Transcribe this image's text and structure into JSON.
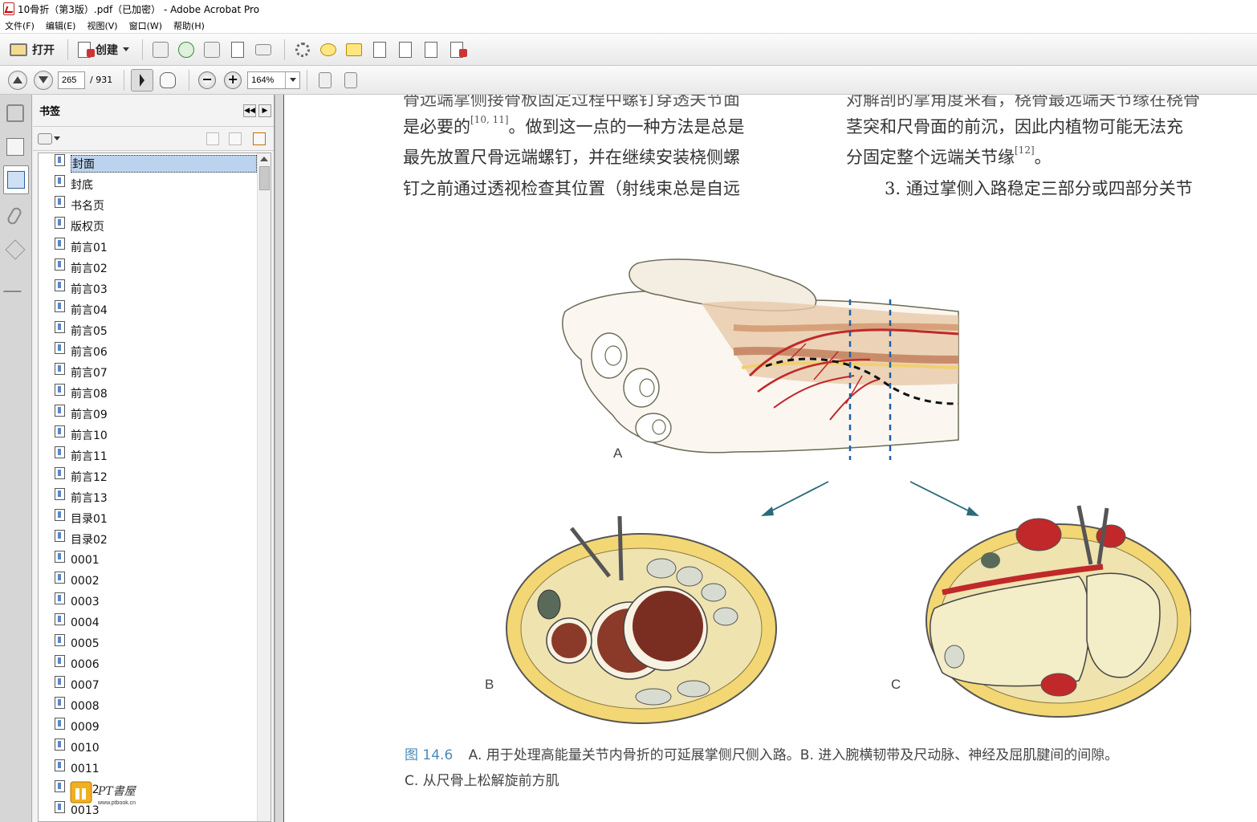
{
  "window": {
    "title": "10骨折（第3版）.pdf（已加密） - Adobe Acrobat Pro"
  },
  "menu": [
    "文件(F)",
    "编辑(E)",
    "视图(V)",
    "窗口(W)",
    "帮助(H)"
  ],
  "toolbar": {
    "open_label": "打开",
    "create_label": "创建"
  },
  "nav": {
    "current_page": "265",
    "total_pages": "/ 931",
    "zoom": "164%"
  },
  "bookmarks_panel": {
    "title": "书签",
    "items": [
      {
        "label": "封面",
        "selected": true
      },
      {
        "label": "封底"
      },
      {
        "label": "书名页"
      },
      {
        "label": "版权页"
      },
      {
        "label": "前言01"
      },
      {
        "label": "前言02"
      },
      {
        "label": "前言03"
      },
      {
        "label": "前言04"
      },
      {
        "label": "前言05"
      },
      {
        "label": "前言06"
      },
      {
        "label": "前言07"
      },
      {
        "label": "前言08"
      },
      {
        "label": "前言09"
      },
      {
        "label": "前言10"
      },
      {
        "label": "前言11"
      },
      {
        "label": "前言12"
      },
      {
        "label": "前言13"
      },
      {
        "label": "目录01"
      },
      {
        "label": "目录02"
      },
      {
        "label": "0001"
      },
      {
        "label": "0002"
      },
      {
        "label": "0003"
      },
      {
        "label": "0004"
      },
      {
        "label": "0005"
      },
      {
        "label": "0006"
      },
      {
        "label": "0007"
      },
      {
        "label": "0008"
      },
      {
        "label": "0009"
      },
      {
        "label": "0010"
      },
      {
        "label": "0011"
      },
      {
        "label": "0012"
      },
      {
        "label": "0013"
      }
    ]
  },
  "document": {
    "left_col": [
      "骨远端掌侧接骨板固定过程中螺钉穿透关节面",
      "是必要的",
      "。做到这一点的一种方法是总是",
      "最先放置尺骨远端螺钉，并在继续安装桡侧螺",
      "钉之前通过透视检查其位置（射线束总是自远"
    ],
    "left_ref": "[10, 11]",
    "right_col": [
      "对解剖的掌角度来看，桡骨最远端关节缘在桡骨",
      "茎突和尺骨面的前沉，因此内植物可能无法充",
      "分固定整个远端关节缘",
      "3. 通过掌侧入路稳定三部分或四部分关节"
    ],
    "right_ref": "[12]",
    "right_end": "。",
    "figure_labels": {
      "a": "A",
      "b": "B",
      "c": "C"
    },
    "caption_fig": "图 14.6",
    "caption_line1": "A. 用于处理高能量关节内骨折的可延展掌侧尺侧入路。B. 进入腕横韧带及尺动脉、神经及屈肌腱间的间隙。",
    "caption_line2": "C. 从尺骨上松解旋前方肌"
  },
  "watermark": {
    "text": "PT書屋",
    "url": "www.ptbook.cn"
  },
  "colors": {
    "accent_blue": "#4a8ab8",
    "selection": "#bcd3ee",
    "artery_red": "#c0282a",
    "incision_blue": "#1f5fa8"
  }
}
